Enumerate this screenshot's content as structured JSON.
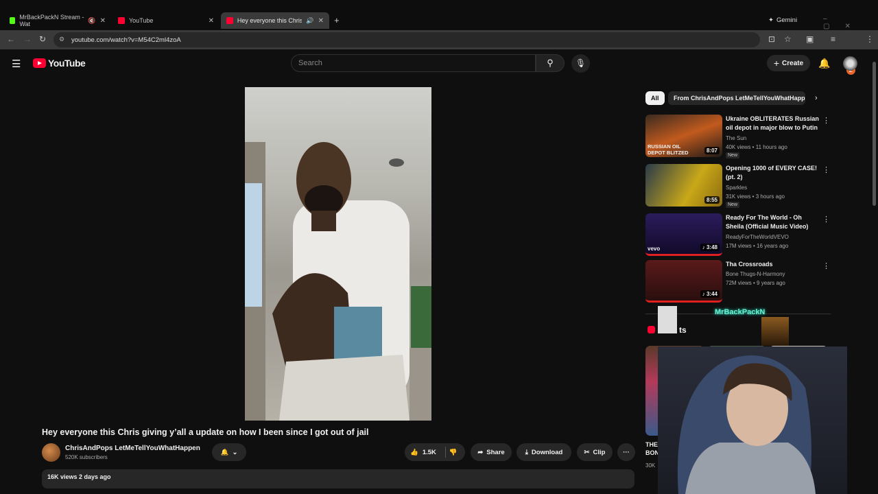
{
  "tabs": [
    {
      "label": "MrBackPackN Stream - Wat",
      "color": "#53fc18"
    },
    {
      "label": "YouTube",
      "color": "#ff0033"
    },
    {
      "label": "Hey everyone this Chris giv",
      "color": "#ff0033"
    }
  ],
  "gemini_label": "Gemini",
  "url": "youtube.com/watch?v=M54C2ml4zoA",
  "profile_initial": "Z",
  "yt": {
    "logo": "YouTube",
    "search_placeholder": "Search",
    "create_label": "Create"
  },
  "video": {
    "title": "Hey everyone this Chris giving y’all a update on how I been since I got out of jail",
    "channel": "ChrisAndPops LetMeTellYouWhatHappen",
    "subscribers": "520K subscribers",
    "likes": "1.5K",
    "share": "Share",
    "download": "Download",
    "clip": "Clip",
    "views_date": "16K views  2 days ago"
  },
  "chips": [
    "All",
    "From ChrisAndPops LetMeTellYouWhatHappe"
  ],
  "recs": [
    {
      "title": "Ukraine OBLITERATES Russian oil depot in major blow to Putin",
      "channel": "The Sun",
      "meta": "40K views • 11 hours ago",
      "badge": "New",
      "duration": "8:07",
      "thumb_text": "RUSSIAN OIL DEPOT BLITZED"
    },
    {
      "title": "Opening 1000 of EVERY CASE! (pt. 2)",
      "channel": "Sparkles",
      "meta": "31K views • 3 hours ago",
      "badge": "New",
      "duration": "8:55"
    },
    {
      "title": "Ready For The World - Oh Sheila (Official Music Video)",
      "channel": "ReadyForTheWorldVEVO",
      "meta": "17M views • 16 years ago",
      "duration": "3:48",
      "thumb_text": "vevo"
    },
    {
      "title": "Tha Crossroads",
      "channel": "Bone Thugs-N-Harmony",
      "meta": "72M views • 9 years ago",
      "duration": "3:44"
    }
  ],
  "shorts": {
    "label": "ts",
    "overlay_name": "MrBackPackN",
    "short1_title": "THE BEST BONUS IN",
    "short1_views": "30K"
  }
}
